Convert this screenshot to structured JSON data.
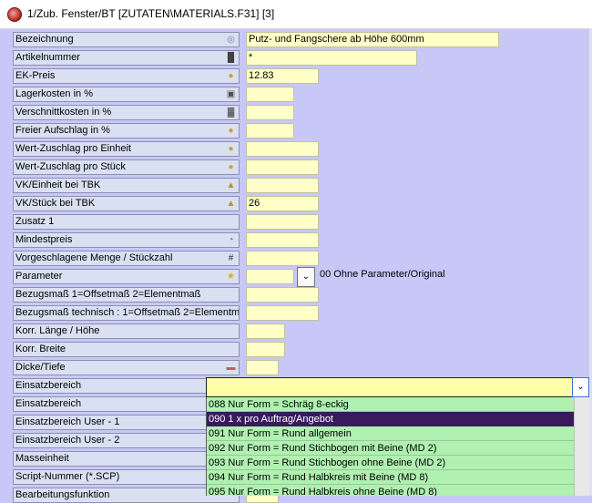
{
  "window": {
    "title": "1/Zub. Fenster/BT [ZUTATEN\\MATERIALS.F31] [3]"
  },
  "rows": [
    {
      "label": "Bezeichnung",
      "icon": "globe-icon",
      "value": "Putz- und Fangschere ab Höhe 600mm"
    },
    {
      "label": "Artikelnummer",
      "icon": "barcode-icon",
      "value": "*"
    },
    {
      "label": "EK-Preis",
      "icon": "coin-icon",
      "value": "12.83"
    },
    {
      "label": "Lagerkosten in %",
      "icon": "box-icon",
      "value": ""
    },
    {
      "label": "Verschnittkosten in %",
      "icon": "scrap-icon",
      "value": ""
    },
    {
      "label": "Freier Aufschlag in %",
      "icon": "coin-icon",
      "value": ""
    },
    {
      "label": "Wert-Zuschlag pro Einheit",
      "icon": "coin-icon",
      "value": ""
    },
    {
      "label": "Wert-Zuschlag pro Stück",
      "icon": "coin-icon",
      "value": ""
    },
    {
      "label": "VK/Einheit bei TBK",
      "icon": "money-bag-icon",
      "value": ""
    },
    {
      "label": "VK/Stück bei TBK",
      "icon": "money-bag-icon",
      "value": "26"
    },
    {
      "label": "Zusatz 1",
      "icon": "",
      "value": ""
    },
    {
      "label": "Mindestpreis",
      "icon": "chart-icon",
      "value": ""
    },
    {
      "label": "Vorgeschlagene Menge / Stückzahl",
      "icon": "hash-icon",
      "value": ""
    },
    {
      "label": "Parameter",
      "icon": "star-icon",
      "value": ""
    },
    {
      "label": "Bezugsmaß 1=Offsetmaß 2=Elementmaß",
      "icon": "",
      "value": ""
    },
    {
      "label": "Bezugsmaß technisch : 1=Offsetmaß 2=Elementmaß",
      "icon": "",
      "value": ""
    },
    {
      "label": "Korr. Länge / Höhe",
      "icon": "",
      "value": ""
    },
    {
      "label": "Korr. Breite",
      "icon": "",
      "value": ""
    },
    {
      "label": "Dicke/Tiefe",
      "icon": "ruler-icon",
      "value": ""
    },
    {
      "label": "Einsatzbereich",
      "icon": "",
      "value": ""
    },
    {
      "label": "Einsatzbereich",
      "icon": "",
      "value": ""
    },
    {
      "label": "Einsatzbereich User - 1",
      "icon": "",
      "value": ""
    },
    {
      "label": "Einsatzbereich User - 2",
      "icon": "",
      "value": ""
    },
    {
      "label": "Masseinheit",
      "icon": "",
      "value": ""
    },
    {
      "label": "Script-Nummer (*.SCP)",
      "icon": "",
      "value": ""
    },
    {
      "label": "Bearbeitungsfunktion",
      "icon": "",
      "value": ""
    }
  ],
  "parameter": {
    "selected_text": "00 Ohne Parameter/Original"
  },
  "einsatzbereich_dropdown": {
    "current_value": "",
    "selected_index": 1,
    "options": [
      "088 Nur Form = Schräg 8-eckig",
      "090 1 x pro Auftrag/Angebot",
      "091 Nur Form = Rund allgemein",
      "092 Nur Form = Rund Stichbogen mit Beine (MD 2)",
      "093 Nur Form = Rund Stichbogen ohne Beine (MD 2)",
      "094 Nur Form = Rund Halbkreis mit Beine (MD 8)",
      "095 Nur Form = Rund Halbkreis ohne Beine (MD 8)"
    ]
  },
  "colors": {
    "background": "#c8c8f8",
    "field": "#ffffc8",
    "list": "#b0f0b0",
    "selected": "#3a1a5e"
  }
}
